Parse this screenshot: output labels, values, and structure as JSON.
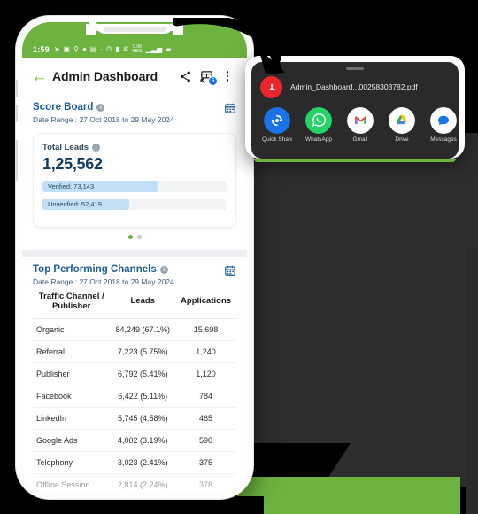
{
  "theme": {
    "brand_green": "#6cb33f",
    "accent_blue": "#1b5e96",
    "badge_blue": "#1a73e8",
    "pdf_red": "#e8262b",
    "bar_fill": "#bfe0f5"
  },
  "phone": {
    "status_bar": {
      "time": "1:59",
      "network_speed": "0.08",
      "network_unit": "KB/S",
      "battery": "48",
      "signal": "4G"
    },
    "appbar": {
      "back_label": "back",
      "title": "Admin Dashboard",
      "share_icon": "share-icon",
      "export_icon": "export-table-icon",
      "export_badge": "5",
      "menu_icon": "more-vertical-icon"
    },
    "scoreboard": {
      "title": "Score Board",
      "date_range": "Date Range : 27 Oct 2018 to 29 May 2024",
      "calendar_icon": "calendar-icon",
      "card": {
        "label": "Total Leads",
        "value": "1,25,562",
        "bars": [
          {
            "label": "Verified: 73,143",
            "percent": 63
          },
          {
            "label": "Unverified: 52,419",
            "percent": 47
          }
        ]
      },
      "pagination": {
        "count": 2,
        "active": 0
      }
    },
    "channels": {
      "title": "Top Performing Channels",
      "date_range": "Date Range : 27 Oct 2018 to 29 May 2024",
      "calendar_icon": "calendar-icon",
      "columns": [
        "Traffic Channel / Publisher",
        "Leads",
        "Applications"
      ],
      "rows": [
        {
          "channel": "Organic",
          "leads": "84,249 (67.1%)",
          "applications": "15,698"
        },
        {
          "channel": "Referral",
          "leads": "7,223 (5.75%)",
          "applications": "1,240"
        },
        {
          "channel": "Publisher",
          "leads": "6,792 (5.41%)",
          "applications": "1,120"
        },
        {
          "channel": "Facebook",
          "leads": "6,422 (5.11%)",
          "applications": "784"
        },
        {
          "channel": "LinkedIn",
          "leads": "5,745 (4.58%)",
          "applications": "465"
        },
        {
          "channel": "Google Ads",
          "leads": "4,002 (3.19%)",
          "applications": "590"
        },
        {
          "channel": "Telephony",
          "leads": "3,023 (2.41%)",
          "applications": "375"
        },
        {
          "channel": "Offline Session",
          "leads": "2,814 (2.24%)",
          "applications": "378"
        }
      ]
    }
  },
  "share_sheet": {
    "file_name": "Admin_Dashboard...00258303782.pdf",
    "file_icon": "pdf-icon",
    "apps": [
      {
        "name": "Quick Share",
        "icon": "quick-share-icon"
      },
      {
        "name": "WhatsApp",
        "icon": "whatsapp-icon"
      },
      {
        "name": "Gmail",
        "icon": "gmail-icon"
      },
      {
        "name": "Drive",
        "icon": "google-drive-icon"
      },
      {
        "name": "Messages",
        "icon": "messages-icon"
      }
    ]
  }
}
